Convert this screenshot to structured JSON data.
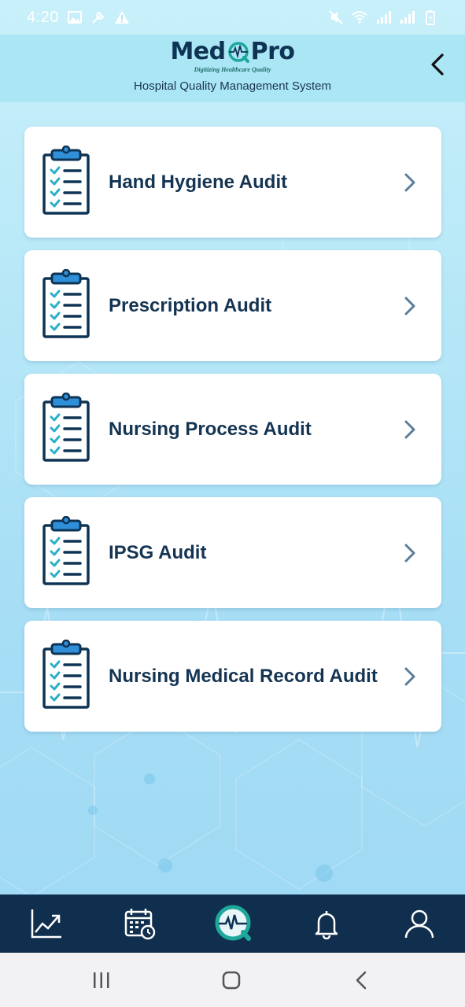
{
  "status_bar": {
    "time": "4:20",
    "left_icons": [
      "gallery-icon",
      "tools-icon",
      "warning-icon"
    ],
    "right_icons": [
      "mute-icon",
      "wifi-icon",
      "signal-icon",
      "signal-icon",
      "battery-icon"
    ]
  },
  "header": {
    "logo_left": "Med",
    "logo_right": "Pro",
    "tagline": "Digitizing Healthcare Quality",
    "subtitle": "Hospital Quality Management System",
    "back_icon": "chevron-left-icon"
  },
  "audits": [
    {
      "label": "Hand Hygiene Audit"
    },
    {
      "label": "Prescription Audit"
    },
    {
      "label": "Nursing Process Audit"
    },
    {
      "label": "IPSG Audit"
    },
    {
      "label": "Nursing Medical Record Audit"
    }
  ],
  "bottom_nav": {
    "items": [
      "chart-icon",
      "calendar-icon",
      "medqpro-home-icon",
      "bell-icon",
      "profile-icon"
    ],
    "active": "medqpro-home-icon"
  },
  "system_nav": [
    "recents-icon",
    "home-icon",
    "back-icon"
  ],
  "colors": {
    "navy": "#102e4d",
    "text": "#143452",
    "accent_teal": "#1ea89c",
    "icon_blue": "#2f8fd8",
    "check_teal": "#2cb0c8",
    "background": "#b4e6f7"
  }
}
